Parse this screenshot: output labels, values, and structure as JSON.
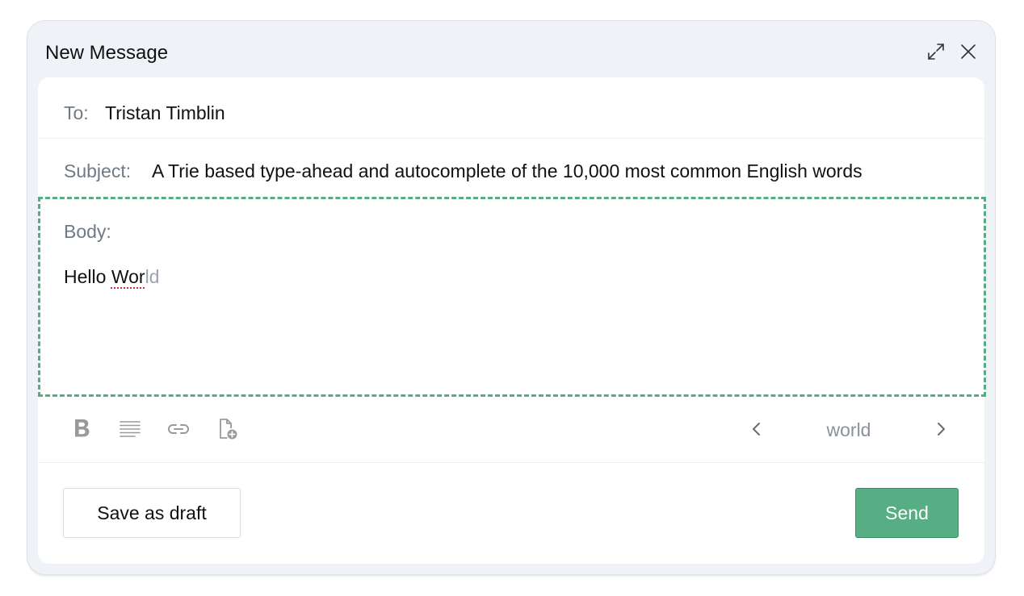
{
  "window": {
    "title": "New Message",
    "expand_icon": "expand-icon",
    "close_icon": "close-icon"
  },
  "to": {
    "label": "To:",
    "value": "Tristan Timblin"
  },
  "subject": {
    "label": "Subject:",
    "value": "A Trie based type-ahead and autocomplete of the 10,000 most common English words"
  },
  "body": {
    "label": "Body:",
    "text_before": "Hello ",
    "text_current": "Wor",
    "completion": "ld"
  },
  "toolbar": {
    "icons": [
      "bold-icon",
      "align-justify-icon",
      "link-icon",
      "attach-file-icon"
    ],
    "suggestion": "world"
  },
  "actions": {
    "draft_label": "Save as draft",
    "send_label": "Send"
  },
  "colors": {
    "accent": "#57ad84",
    "border_dashed": "#58ac82",
    "window_bg": "#eff3f8",
    "label_gray": "#6f7a86",
    "ghost_text": "#9aa3ad",
    "spell_error": "#d23030"
  }
}
